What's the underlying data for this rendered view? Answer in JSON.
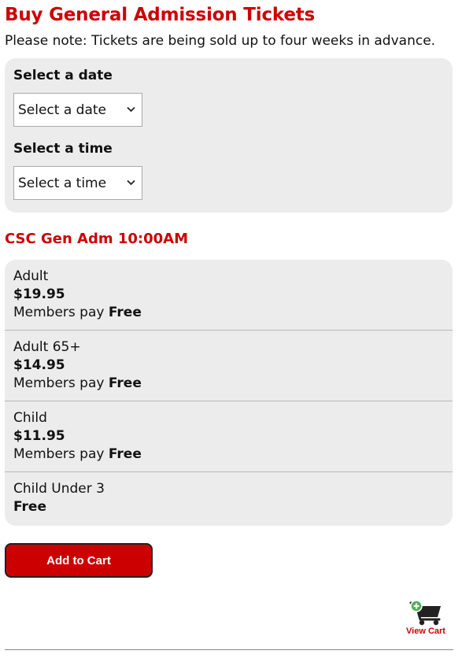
{
  "header": {
    "title": "Buy General Admission Tickets",
    "note": "Please note: Tickets are being sold up to four weeks in advance."
  },
  "date_field": {
    "label": "Select a date",
    "selected": "Select a date"
  },
  "time_field": {
    "label": "Select a time",
    "selected": "Select a time"
  },
  "event": {
    "title": "CSC Gen Adm 10:00AM"
  },
  "tickets": [
    {
      "name": "Adult",
      "price": "$19.95",
      "member_prefix": "Members pay",
      "member_price": "Free"
    },
    {
      "name": "Adult 65+",
      "price": "$14.95",
      "member_prefix": "Members pay",
      "member_price": "Free"
    },
    {
      "name": "Child",
      "price": "$11.95",
      "member_prefix": "Members pay",
      "member_price": "Free"
    },
    {
      "name": "Child Under 3",
      "price": "Free"
    }
  ],
  "actions": {
    "add_to_cart": "Add to Cart",
    "view_cart": "View Cart"
  },
  "colors": {
    "accent": "#cc0000",
    "panel_bg": "#ececec",
    "cart_plus": "#4caf50"
  }
}
